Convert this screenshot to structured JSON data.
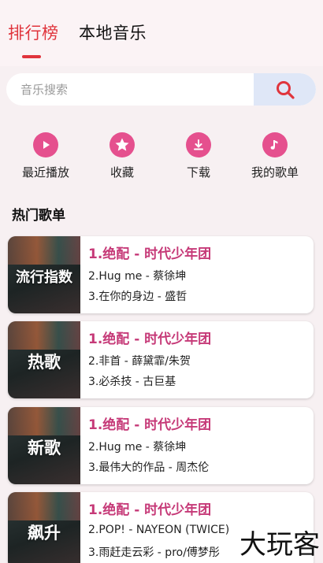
{
  "tabs": [
    {
      "label": "排行榜",
      "active": true
    },
    {
      "label": "本地音乐",
      "active": false
    }
  ],
  "search": {
    "placeholder": "音乐搜索",
    "value": ""
  },
  "quick_actions": [
    {
      "label": "最近播放",
      "icon": "play-icon"
    },
    {
      "label": "收藏",
      "icon": "star-icon"
    },
    {
      "label": "下载",
      "icon": "download-icon"
    },
    {
      "label": "我的歌单",
      "icon": "music-note-icon"
    }
  ],
  "section_title": "热门歌单",
  "playlists": [
    {
      "cover_label": "流行指数",
      "songs": [
        "1.绝配 - 时代少年团",
        "2.Hug me - 蔡徐坤",
        "3.在你的身边 - 盛哲"
      ]
    },
    {
      "cover_label": "热歌",
      "songs": [
        "1.绝配 - 时代少年团",
        "2.非首 - 薛黛霏/朱贺",
        "3.必杀技 - 古巨基"
      ]
    },
    {
      "cover_label": "新歌",
      "songs": [
        "1.绝配 - 时代少年团",
        "2.Hug me - 蔡徐坤",
        "3.最伟大的作品 - 周杰伦"
      ]
    },
    {
      "cover_label": "飙升",
      "songs": [
        "1.绝配 - 时代少年团",
        "2.POP! - NAYEON (TWICE)",
        "3.雨赶走云彩 - pro/傅梦彤"
      ]
    }
  ],
  "watermark": "大玩客",
  "colors": {
    "accent": "#e0343c",
    "pink": "#e5508e",
    "song_highlight": "#c63a78"
  }
}
